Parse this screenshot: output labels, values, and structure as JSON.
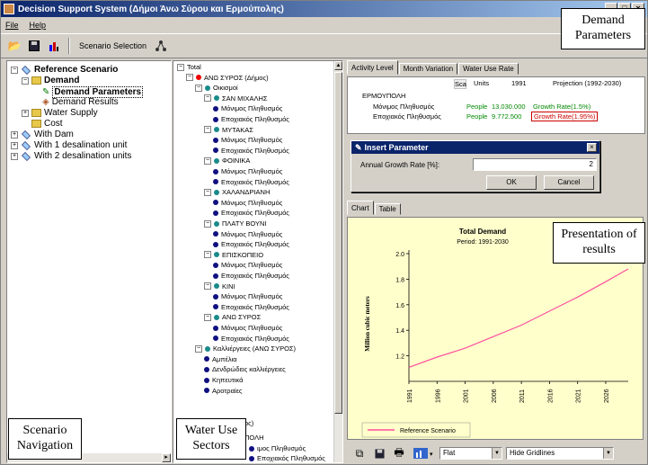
{
  "window": {
    "title": "Decision Support System (Δήμοι Άνω Σύρου και Ερμούπολης)",
    "min_glyph": "_",
    "max_glyph": "□",
    "close_glyph": "×"
  },
  "menu": [
    "File",
    "Help"
  ],
  "toolbar": {
    "scenario_selection_label": "Scenario Selection"
  },
  "scenario_tree": [
    {
      "label": "Reference Scenario",
      "bold": true,
      "expander": "−",
      "icon": "ref"
    },
    {
      "label": "Demand",
      "bold": true,
      "expander": "−",
      "icon": "folder"
    },
    {
      "label": "Demand Parameters",
      "bold": true,
      "expander": "",
      "icon": "param",
      "selected": true
    },
    {
      "label": "Demand Results",
      "bold": false,
      "expander": "",
      "icon": "result"
    },
    {
      "label": "Water Supply",
      "bold": false,
      "expander": "+",
      "icon": "folder"
    },
    {
      "label": "Cost",
      "bold": false,
      "expander": "",
      "icon": "folder"
    },
    {
      "label": "With Dam",
      "bold": false,
      "expander": "+",
      "icon": "ref"
    },
    {
      "label": "With 1 desalination unit",
      "bold": false,
      "expander": "+",
      "icon": "ref"
    },
    {
      "label": "With 2 desalination units",
      "bold": false,
      "expander": "+",
      "icon": "ref"
    }
  ],
  "sectors_tree": [
    {
      "label": "Total",
      "level": 0,
      "dot": "",
      "expander": "−"
    },
    {
      "label": "ΑΝΩ ΣΥΡΟΣ (Δήμος)",
      "level": 1,
      "dot": "red",
      "expander": "−"
    },
    {
      "label": "Οικισμοί",
      "level": 2,
      "dot": "teal",
      "expander": "−"
    },
    {
      "label": "ΣΑΝ ΜΙΧΑΛΗΣ",
      "level": 3,
      "dot": "teal",
      "expander": "−"
    },
    {
      "label": "Μόνιμος Πληθυσμός",
      "level": 4,
      "dot": "navy",
      "expander": ""
    },
    {
      "label": "Εποχιακός Πληθυσμός",
      "level": 4,
      "dot": "navy",
      "expander": ""
    },
    {
      "label": "ΜΥΤΑΚΑΣ",
      "level": 3,
      "dot": "teal",
      "expander": "−"
    },
    {
      "label": "Μόνιμος Πληθυσμός",
      "level": 4,
      "dot": "navy",
      "expander": ""
    },
    {
      "label": "Εποχιακός Πληθυσμός",
      "level": 4,
      "dot": "navy",
      "expander": ""
    },
    {
      "label": "ΦΟΙΝΙΚΑ",
      "level": 3,
      "dot": "teal",
      "expander": "−"
    },
    {
      "label": "Μόνιμος Πληθυσμός",
      "level": 4,
      "dot": "navy",
      "expander": ""
    },
    {
      "label": "Εποχιακός Πληθυσμός",
      "level": 4,
      "dot": "navy",
      "expander": ""
    },
    {
      "label": "ΧΑΛΑΝΔΡΙΑΝΗ",
      "level": 3,
      "dot": "teal",
      "expander": "−"
    },
    {
      "label": "Μόνιμος Πληθυσμός",
      "level": 4,
      "dot": "navy",
      "expander": ""
    },
    {
      "label": "Εποχιακός Πληθυσμός",
      "level": 4,
      "dot": "navy",
      "expander": ""
    },
    {
      "label": "ΠΛΑΤΥ ΒΟΥΝΙ",
      "level": 3,
      "dot": "teal",
      "expander": "−"
    },
    {
      "label": "Μόνιμος Πληθυσμός",
      "level": 4,
      "dot": "navy",
      "expander": ""
    },
    {
      "label": "Εποχιακός Πληθυσμός",
      "level": 4,
      "dot": "navy",
      "expander": ""
    },
    {
      "label": "ΕΠΙΣΚΟΠΕΙΟ",
      "level": 3,
      "dot": "teal",
      "expander": "−"
    },
    {
      "label": "Μόνιμος Πληθυσμός",
      "level": 4,
      "dot": "navy",
      "expander": ""
    },
    {
      "label": "Εποχιακός Πληθυσμός",
      "level": 4,
      "dot": "navy",
      "expander": ""
    },
    {
      "label": "ΚΙΝΙ",
      "level": 3,
      "dot": "teal",
      "expander": "−"
    },
    {
      "label": "Μόνιμος Πληθυσμός",
      "level": 4,
      "dot": "navy",
      "expander": ""
    },
    {
      "label": "Εποχιακός Πληθυσμός",
      "level": 4,
      "dot": "navy",
      "expander": ""
    },
    {
      "label": "ΑΝΩ ΣΥΡΟΣ",
      "level": 3,
      "dot": "teal",
      "expander": "−"
    },
    {
      "label": "Μόνιμος Πληθυσμός",
      "level": 4,
      "dot": "navy",
      "expander": ""
    },
    {
      "label": "Εποχιακός Πληθυσμός",
      "level": 4,
      "dot": "navy",
      "expander": ""
    },
    {
      "label": "Καλλιέργειες (ΑΝΩ ΣΥΡΟΣ)",
      "level": 2,
      "dot": "teal",
      "expander": "−"
    },
    {
      "label": "Αμπέλια",
      "level": 3,
      "dot": "navy",
      "expander": ""
    },
    {
      "label": "Δενδρώδεις καλλιέργειες",
      "level": 3,
      "dot": "navy",
      "expander": ""
    },
    {
      "label": "Κηπευτικά",
      "level": 3,
      "dot": "navy",
      "expander": ""
    },
    {
      "label": "Αροτραίες",
      "level": 3,
      "dot": "navy",
      "expander": ""
    }
  ],
  "sectors_tail": {
    "municipality_fragment": "(Δήμος)",
    "place_fragment": "ΥΠΟΛΗ",
    "item1": "ιμος Πληθυσμός",
    "item2": "Εποχιακός Πληθυσμός"
  },
  "annotations": {
    "demand_parameters": "Demand Parameters",
    "presentation": "Presentation of results",
    "scenario_navigation": "Scenario Navigation",
    "water_use_sectors": "Water Use Sectors"
  },
  "param_tabs": [
    "Activity Level",
    "Month Variation",
    "Water Use Rate"
  ],
  "param_grid": {
    "headers": [
      "Sca",
      "Units",
      "1991",
      "Projection (1992-2030)"
    ],
    "region": "ΕΡΜΟΥΠΟΛΗ",
    "rows": [
      {
        "label": "Μόνιμος Πληθυσμός",
        "units": "People",
        "value": "13.030.000",
        "projection": "Growth Rate(1.5%)"
      },
      {
        "label": "Εποχιακός Πληθυσμός",
        "units": "People",
        "value": "9.772.500",
        "projection": "Growth Rate(1.95%)"
      }
    ]
  },
  "dialog": {
    "title": "Insert Parameter",
    "field_label": "Annual Growth Rate [%]:",
    "field_value": "2",
    "ok_label": "OK",
    "cancel_label": "Cancel"
  },
  "chart_tabs": [
    "Chart",
    "Table"
  ],
  "bottom_bar": {
    "style_value": "Flat",
    "gridlines_value": "Hide Gridlines"
  },
  "colors": {
    "curve": "#ff4fa0",
    "chart_bg": "#ffffcc"
  },
  "chart_data": {
    "type": "line",
    "title": "Total Demand",
    "subtitle": "Period: 1991-2030",
    "ylabel": "Million cubic meters",
    "ylim": [
      1.0,
      2.0
    ],
    "yticks": [
      "1.2",
      "1.4",
      "1.6",
      "1.8",
      "2.0"
    ],
    "xticks": [
      "1991",
      "1996",
      "2001",
      "2006",
      "2011",
      "2016",
      "2021",
      "2026"
    ],
    "xlim": [
      1991,
      2030
    ],
    "grid": false,
    "legend_position": "bottom-left",
    "series": [
      {
        "name": "Reference Scenario",
        "x": [
          1991,
          1996,
          2001,
          2006,
          2011,
          2016,
          2021,
          2026,
          2030
        ],
        "values": [
          1.11,
          1.19,
          1.26,
          1.35,
          1.44,
          1.55,
          1.66,
          1.78,
          1.88
        ]
      }
    ]
  }
}
